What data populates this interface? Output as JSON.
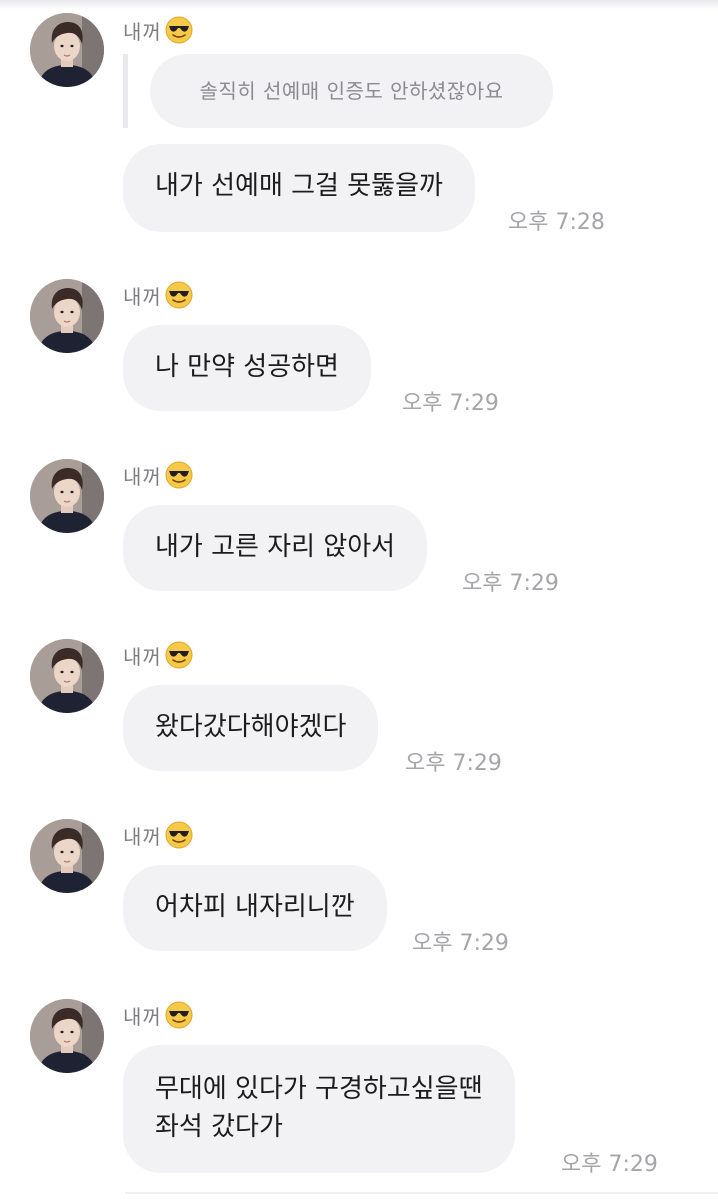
{
  "sender_name": "내꺼",
  "emoji": "smiling-face-with-sunglasses",
  "reply": {
    "quoted_text": "솔직히 선예매 인증도 안하셨잖아요"
  },
  "messages": [
    {
      "text": "내가 선예매 그걸 못뚫을까",
      "time": "오후 7:28"
    },
    {
      "text": "나 만약 성공하면",
      "time": "오후 7:29"
    },
    {
      "text": "내가 고른 자리 앉아서",
      "time": "오후 7:29"
    },
    {
      "text": "왔다갔다해야겠다",
      "time": "오후 7:29"
    },
    {
      "text": "어차피 내자리니깐",
      "time": "오후 7:29"
    },
    {
      "text": "무대에 있다가 구경하고싶을땐\n좌석 갔다가",
      "time": "오후 7:29"
    }
  ],
  "colors": {
    "bubble": "#f2f2f4",
    "text": "#1c1c1e",
    "meta": "#a5a5aa"
  }
}
